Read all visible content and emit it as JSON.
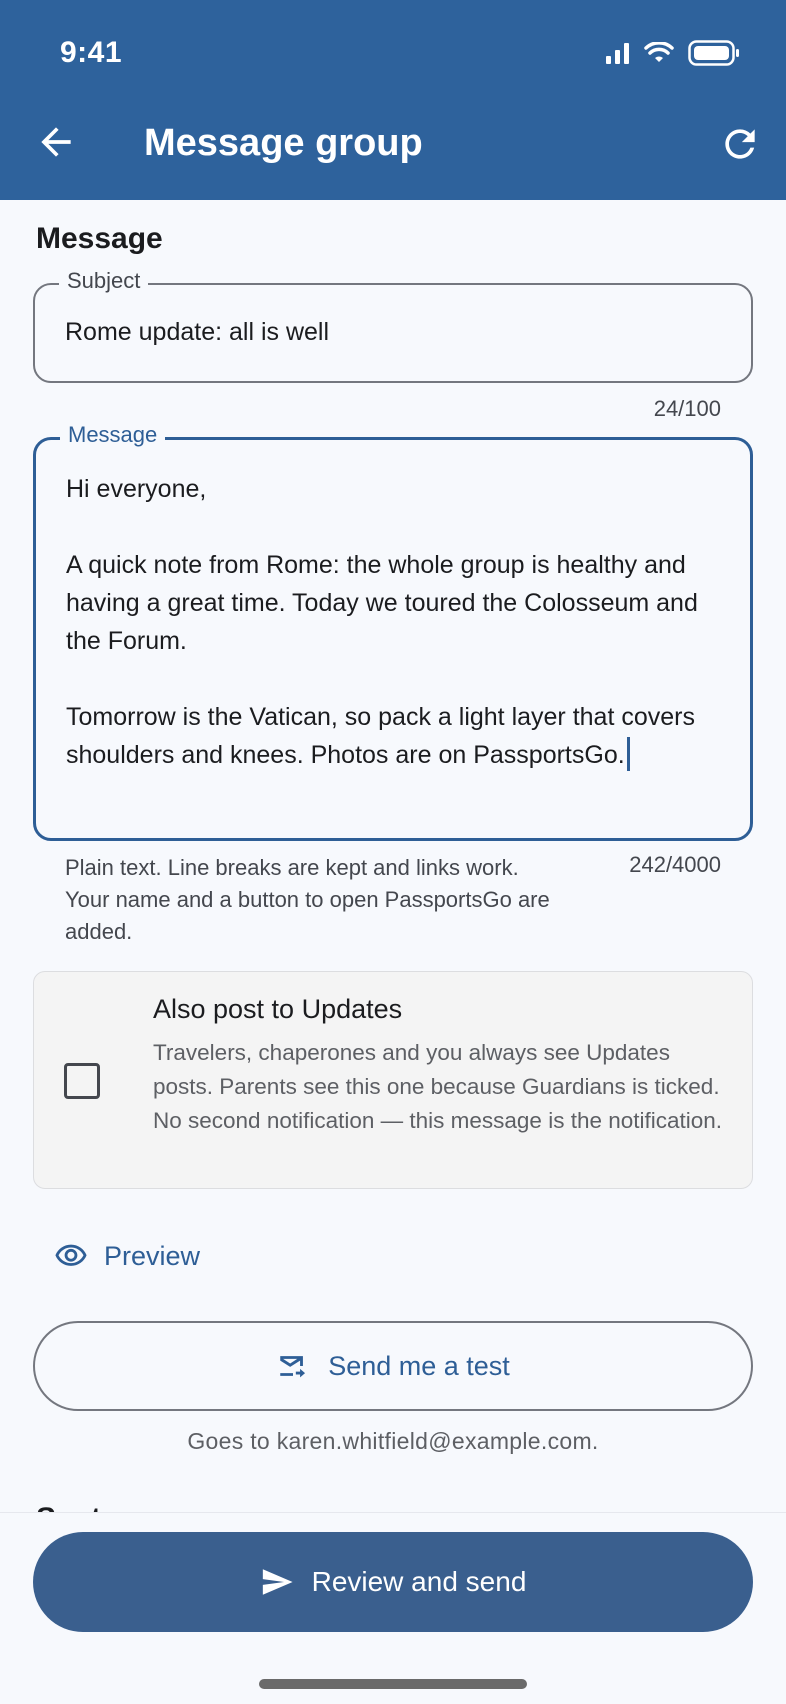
{
  "status_bar": {
    "time": "9:41"
  },
  "app_bar": {
    "title": "Message group"
  },
  "section": {
    "title": "Message"
  },
  "subject": {
    "label": "Subject",
    "value": "Rome update: all is well",
    "counter": "24/100"
  },
  "message": {
    "label": "Message",
    "value": "Hi everyone,\n\nA quick note from Rome: the whole group is healthy and having a great time. Today we toured the Colosseum and the Forum.\n\nTomorrow is the Vatican, so pack a light layer that covers shoulders and knees. Photos are on PassportsGo.",
    "helper": "Plain text. Line breaks are kept and links work. Your name and a button to open PassportsGo are added.",
    "counter": "242/4000"
  },
  "updates": {
    "title": "Also post to Updates",
    "description": "Travelers, chaperones and you always see Updates posts. Parents see this one because Guardians is ticked. No second notification — this message is the notification.",
    "checked": false
  },
  "preview": {
    "label": "Preview",
    "icon": "eye-icon"
  },
  "test": {
    "label": "Send me a test",
    "icon": "mail-forward-icon",
    "note": "Goes to karen.whitfield@example.com."
  },
  "send": {
    "label": "Review and send",
    "icon": "send-icon"
  },
  "colors": {
    "primary": "#2e629c",
    "accent": "#2e5e96",
    "send_button": "#3a5f8e",
    "background": "#f7f9fd"
  }
}
